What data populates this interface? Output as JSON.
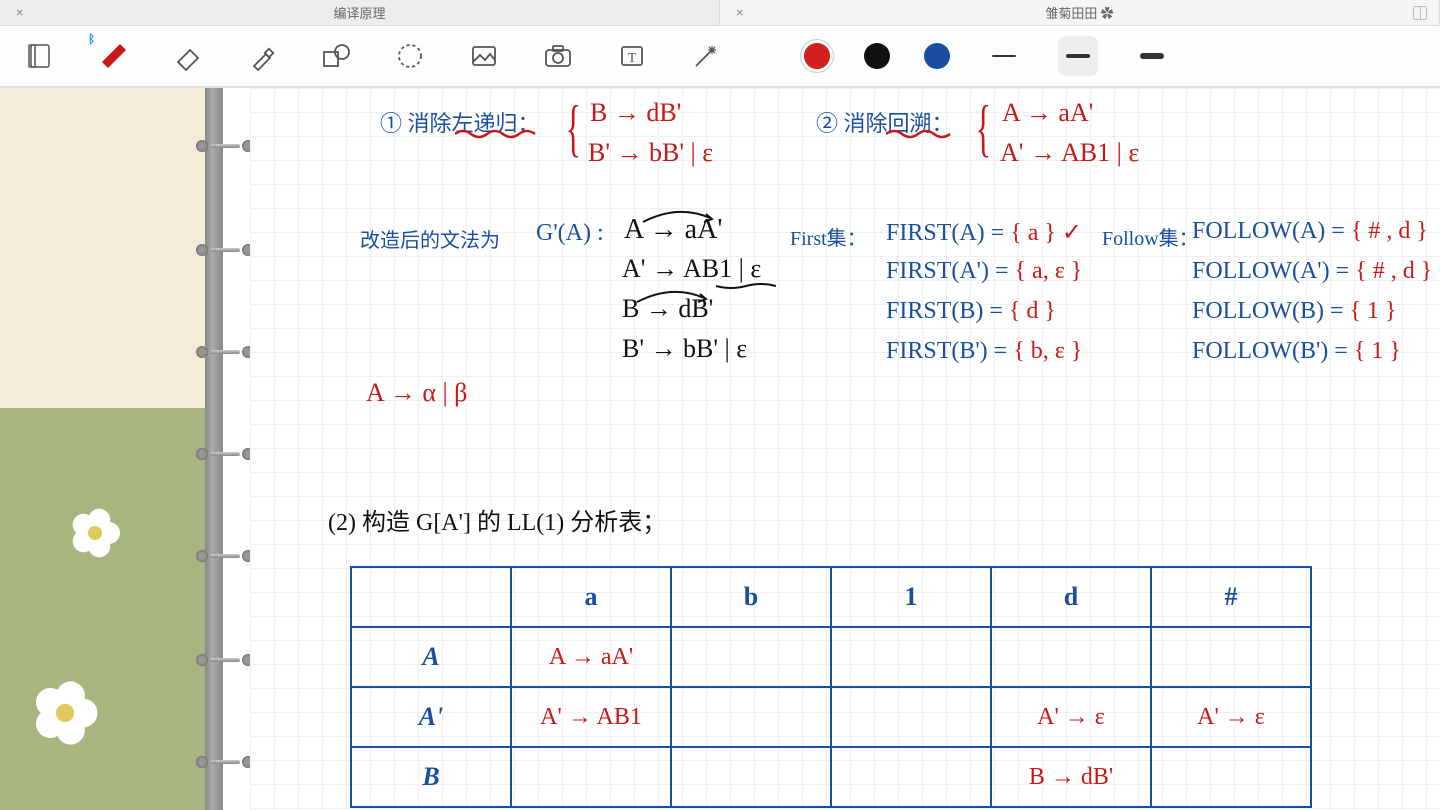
{
  "tabs": {
    "left": "编译原理",
    "right": "雏菊田田 ✿"
  },
  "toolbar": {
    "icons": [
      "notebook",
      "pen",
      "eraser",
      "highlighter",
      "shapes",
      "lasso",
      "image",
      "camera",
      "text",
      "magic"
    ]
  },
  "notes": {
    "step1_label": "① 消除左递归：",
    "step1_prod1": "B → dB'",
    "step1_prod2": "B' → bB' | ε",
    "step2_label": "② 消除回溯：",
    "step2_prod1": "A → aA'",
    "step2_prod2": "A' → AB1 | ε",
    "grammar_label": "改造后的文法为",
    "grammar_head": "G'(A) :",
    "grammar_p1": "A → aA'",
    "grammar_p2": "A' → AB1 | ε",
    "grammar_p3": "B → dB'",
    "grammar_p4": "B' → bB' | ε",
    "aside": "A → α | β",
    "first_label": "First集：",
    "first_a": "FIRST(A) = { a } ✓",
    "first_ap": "FIRST(A') = { a, ε }",
    "first_b": "FIRST(B) = { d }",
    "first_bp": "FIRST(B') = { b, ε }",
    "follow_label": "Follow集：",
    "follow_a": "FOLLOW(A) = { # , d }",
    "follow_ap": "FOLLOW(A') = { # , d }",
    "follow_b": "FOLLOW(B) = { 1 }",
    "follow_bp": "FOLLOW(B') = { 1 }",
    "q2": "(2) 构造 G[A'] 的 LL(1) 分析表；"
  },
  "table": {
    "cols": [
      "a",
      "b",
      "1",
      "d",
      "#"
    ],
    "rows": [
      "A",
      "A'",
      "B"
    ],
    "cells": {
      "A": {
        "a": "A → aA'",
        "b": "",
        "1": "",
        "d": "",
        "#": ""
      },
      "A'": {
        "a": "A' → AB1",
        "b": "",
        "1": "",
        "d": "A' → ε",
        "#": "A' → ε"
      },
      "B": {
        "a": "",
        "b": "",
        "1": "",
        "d": "B → dB'",
        "#": ""
      }
    }
  }
}
